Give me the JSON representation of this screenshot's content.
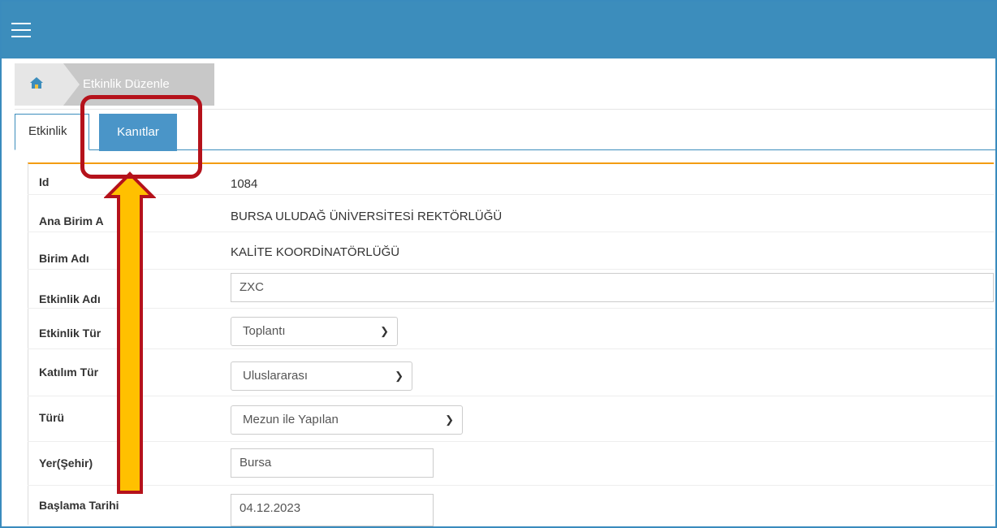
{
  "topbar": {
    "menu_icon": "hamburger-menu-icon",
    "color": "#3c8dbc"
  },
  "breadcrumb": {
    "home_icon": "home-icon",
    "current": "Etkinlik Düzenle"
  },
  "tabs": [
    {
      "label": "Etkinlik"
    },
    {
      "label": "Kanıtlar"
    }
  ],
  "form": {
    "id": {
      "label": "Id",
      "value": "1084"
    },
    "ana_birim": {
      "label": "Ana Birim A",
      "value": "BURSA ULUDAĞ ÜNİVERSİTESİ REKTÖRLÜĞÜ"
    },
    "birim": {
      "label": "Birim Adı",
      "value": "KALİTE KOORDİNATÖRLÜĞÜ"
    },
    "etkinlik_adi": {
      "label": "Etkinlik Adı",
      "value": "ZXC"
    },
    "etkinlik_turu": {
      "label": "Etkinlik Tür",
      "value": "Toplantı"
    },
    "katilim_turu": {
      "label": "Katılım Tür",
      "value": "Uluslararası"
    },
    "turu": {
      "label": "Türü",
      "value": "Mezun ile Yapılan"
    },
    "yer": {
      "label": "Yer(Şehir)",
      "value": "Bursa"
    },
    "baslama": {
      "label": "Başlama Tarihi",
      "value": "04.12.2023"
    }
  },
  "annotation": {
    "box_color": "#b5121b",
    "arrow_color": "#ffc000",
    "arrow_outline": "#b5121b"
  }
}
